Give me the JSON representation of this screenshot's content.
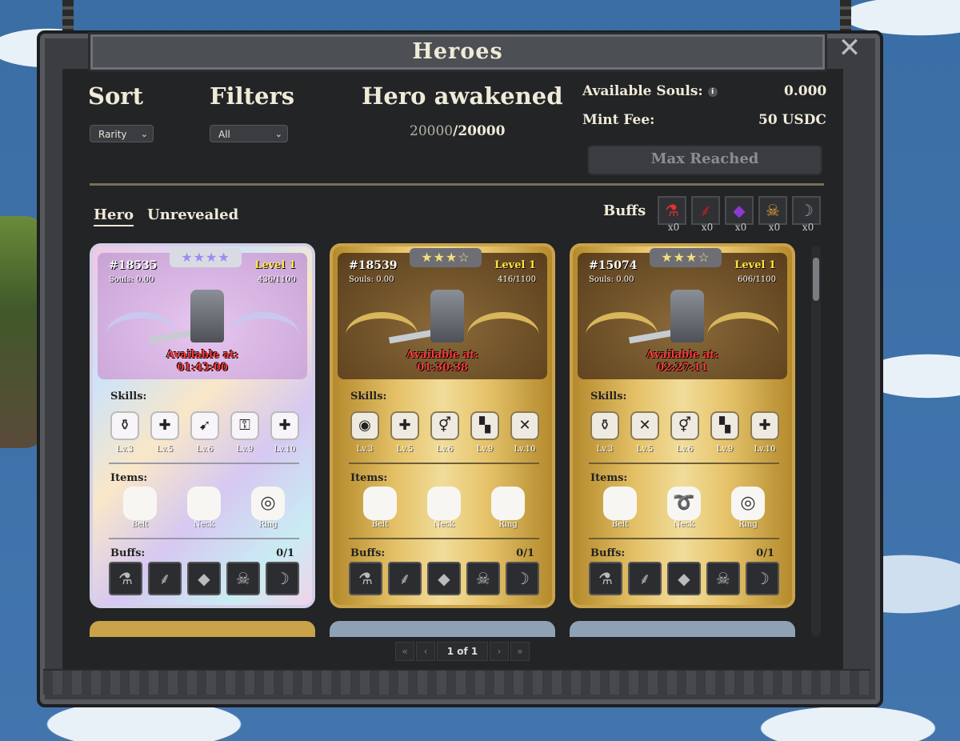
{
  "window": {
    "title": "Heroes"
  },
  "sort": {
    "label": "Sort",
    "value": "Rarity"
  },
  "filters": {
    "label": "Filters",
    "value": "All"
  },
  "awakened": {
    "label": "Hero awakened",
    "current": "20000",
    "sep": "/",
    "max": "20000"
  },
  "souls": {
    "label": "Available Souls:",
    "value": "0.000"
  },
  "mint": {
    "label": "Mint Fee:",
    "value": "50 USDC"
  },
  "max_button": "Max Reached",
  "tabs": [
    {
      "label": "Hero",
      "active": true
    },
    {
      "label": "Unrevealed",
      "active": false
    }
  ],
  "buffs": {
    "label": "Buffs",
    "items": [
      {
        "icon": "potion-icon",
        "glyph": "⚗",
        "count": "x0",
        "color": "#d33"
      },
      {
        "icon": "branch-icon",
        "glyph": "⸙",
        "count": "x0",
        "color": "#b22"
      },
      {
        "icon": "crystal-icon",
        "glyph": "◆",
        "count": "x0",
        "color": "#8a3ad0"
      },
      {
        "icon": "skull-icon",
        "glyph": "☠",
        "count": "x0",
        "color": "#e2a23a"
      },
      {
        "icon": "scythe-icon",
        "glyph": "☽",
        "count": "x0",
        "color": "#999"
      }
    ]
  },
  "cards": [
    {
      "style": "holo",
      "id": "#18535",
      "souls": "Souls: 0.00",
      "level": "Level 1",
      "xp": "436/1100",
      "stars": "★★★★",
      "avail_label": "Available at:",
      "avail_time": "01:43:00",
      "skills_label": "Skills:",
      "skills": [
        {
          "g": "⚱",
          "lv": "Lv.3"
        },
        {
          "g": "✚",
          "lv": "Lv.5"
        },
        {
          "g": "➹",
          "lv": "Lv.6"
        },
        {
          "g": "⚿",
          "lv": "Lv.9"
        },
        {
          "g": "✚",
          "lv": "Lv.10"
        }
      ],
      "items_label": "Items:",
      "items": [
        {
          "g": "",
          "nm": "Belt"
        },
        {
          "g": "",
          "nm": "Neck"
        },
        {
          "g": "◎",
          "nm": "Ring"
        }
      ],
      "buffs_label": "Buffs:",
      "buffs_count": "0/1"
    },
    {
      "style": "gold",
      "id": "#18539",
      "souls": "Souls: 0.00",
      "level": "Level 1",
      "xp": "416/1100",
      "stars": "★★★☆",
      "avail_label": "Available at:",
      "avail_time": "01:30:38",
      "skills_label": "Skills:",
      "skills": [
        {
          "g": "◉",
          "lv": "Lv.3"
        },
        {
          "g": "✚",
          "lv": "Lv.5"
        },
        {
          "g": "⚥",
          "lv": "Lv.6"
        },
        {
          "g": "▚",
          "lv": "Lv.9"
        },
        {
          "g": "✕",
          "lv": "Lv.10"
        }
      ],
      "items_label": "Items:",
      "items": [
        {
          "g": "",
          "nm": "Belt"
        },
        {
          "g": "",
          "nm": "Neck"
        },
        {
          "g": "",
          "nm": "Ring"
        }
      ],
      "buffs_label": "Buffs:",
      "buffs_count": "0/1"
    },
    {
      "style": "gold",
      "id": "#15074",
      "souls": "Souls: 0.00",
      "level": "Level 1",
      "xp": "606/1100",
      "stars": "★★★☆",
      "avail_label": "Available at:",
      "avail_time": "02:27:11",
      "skills_label": "Skills:",
      "skills": [
        {
          "g": "⚱",
          "lv": "Lv.3"
        },
        {
          "g": "✕",
          "lv": "Lv.5"
        },
        {
          "g": "⚥",
          "lv": "Lv.6"
        },
        {
          "g": "▚",
          "lv": "Lv.9"
        },
        {
          "g": "✚",
          "lv": "Lv.10"
        }
      ],
      "items_label": "Items:",
      "items": [
        {
          "g": "",
          "nm": "Belt"
        },
        {
          "g": "➰",
          "nm": "Neck"
        },
        {
          "g": "◎",
          "nm": "Ring"
        }
      ],
      "buffs_label": "Buffs:",
      "buffs_count": "0/1"
    }
  ],
  "card_buff_slots": [
    "⚗",
    "⸙",
    "◆",
    "☠",
    "☽"
  ],
  "pagination": {
    "first": "«",
    "prev": "‹",
    "info": "1 of 1",
    "next": "›",
    "last": "»"
  }
}
